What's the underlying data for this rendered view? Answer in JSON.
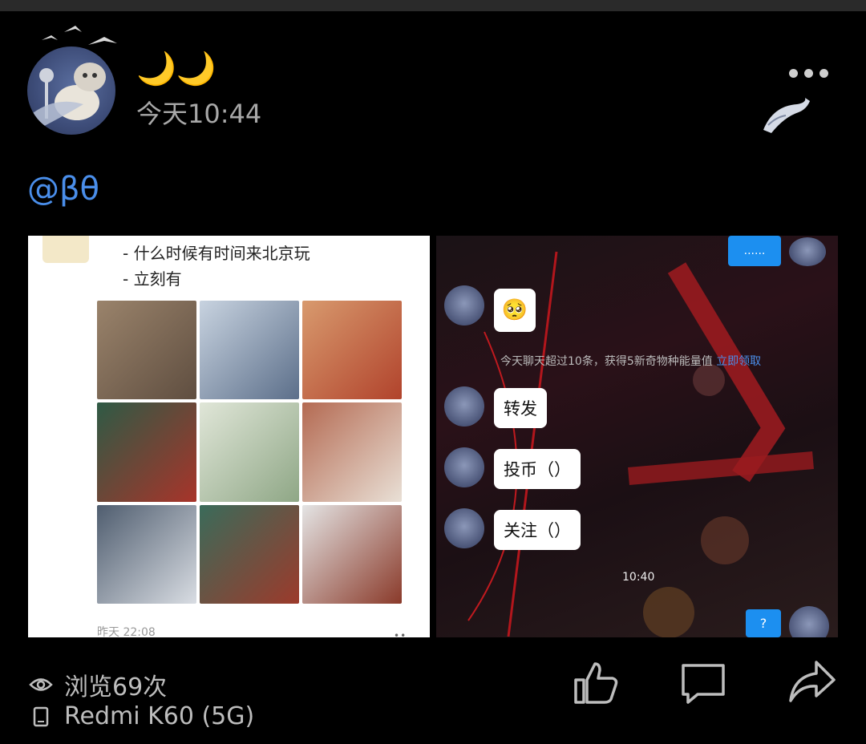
{
  "post": {
    "username": "🌙🌙",
    "timestamp": "今天10:44",
    "mention": "@βθ"
  },
  "left_image": {
    "lines": [
      "- 什么时候有时间来北京玩",
      "- 立刻有"
    ],
    "time": "昨天 22:08",
    "dots": "••",
    "photos": [
      "#8a7560",
      "#6e7f95",
      "#c05a3a",
      "#7a3a2a",
      "#a9b8a0",
      "#9a6a55",
      "#7c8fa8",
      "#4d6a58",
      "#b9a08a"
    ]
  },
  "right_image": {
    "top_button": "......",
    "system_note": "今天聊天超过10条，获得5新奇物种能量值",
    "system_link": "立即领取",
    "emoji": "🥺",
    "bubbles": [
      "转发",
      "投币（）",
      "关注（）"
    ],
    "chat_time": "10:40",
    "bottom_button": "?"
  },
  "footer": {
    "views": "浏览69次",
    "device": "Redmi K60 (5G)"
  },
  "colors": {
    "accent": "#4a8eea",
    "username": "#f2c23a",
    "background": "#000000"
  },
  "icons": [
    "eye-icon",
    "phone-icon",
    "like-icon",
    "comment-icon",
    "share-icon",
    "more-icon"
  ]
}
